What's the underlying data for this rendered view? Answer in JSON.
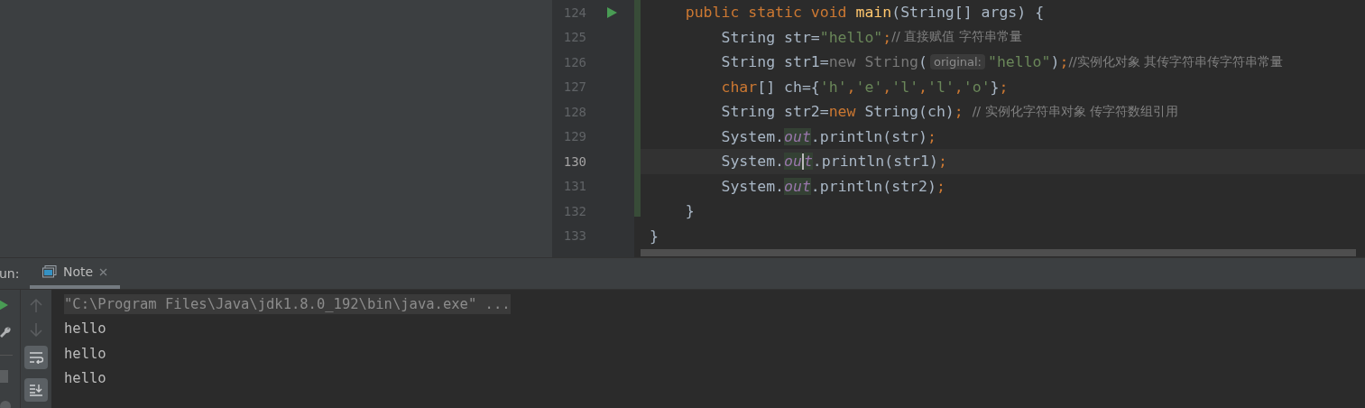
{
  "editor": {
    "lines": [
      {
        "number": "124",
        "current": false,
        "run_marker": true,
        "tokens": [
          {
            "kind": "keyword",
            "text": "    public static void "
          },
          {
            "kind": "method",
            "text": "main"
          },
          {
            "kind": "plain",
            "text": "(String[] args) {"
          }
        ]
      },
      {
        "number": "125",
        "current": false,
        "run_marker": false,
        "tokens": [
          {
            "kind": "plain",
            "text": "        String str="
          },
          {
            "kind": "string",
            "text": "\"hello\""
          },
          {
            "kind": "keyword",
            "text": ";"
          },
          {
            "kind": "comment",
            "text": "// 直接赋值 字符串常量"
          }
        ]
      },
      {
        "number": "126",
        "current": false,
        "run_marker": false,
        "tokens": [
          {
            "kind": "plain",
            "text": "        String str1="
          },
          {
            "kind": "dim",
            "text": "new String"
          },
          {
            "kind": "plain",
            "text": "("
          },
          {
            "kind": "hint",
            "text": "original:"
          },
          {
            "kind": "string",
            "text": "\"hello\""
          },
          {
            "kind": "plain",
            "text": ")"
          },
          {
            "kind": "keyword",
            "text": ";"
          },
          {
            "kind": "comment",
            "text": "//实例化对象 其传字符串传字符串常量"
          }
        ]
      },
      {
        "number": "127",
        "current": false,
        "run_marker": false,
        "tokens": [
          {
            "kind": "keyword",
            "text": "        char"
          },
          {
            "kind": "plain",
            "text": "[] ch={"
          },
          {
            "kind": "string",
            "text": "'h'"
          },
          {
            "kind": "keyword",
            "text": ","
          },
          {
            "kind": "string",
            "text": "'e'"
          },
          {
            "kind": "keyword",
            "text": ","
          },
          {
            "kind": "string",
            "text": "'l'"
          },
          {
            "kind": "keyword",
            "text": ","
          },
          {
            "kind": "string",
            "text": "'l'"
          },
          {
            "kind": "keyword",
            "text": ","
          },
          {
            "kind": "string",
            "text": "'o'"
          },
          {
            "kind": "plain",
            "text": "}"
          },
          {
            "kind": "keyword",
            "text": ";"
          }
        ]
      },
      {
        "number": "128",
        "current": false,
        "run_marker": false,
        "tokens": [
          {
            "kind": "plain",
            "text": "        String str2="
          },
          {
            "kind": "keyword",
            "text": "new "
          },
          {
            "kind": "plain",
            "text": "String(ch)"
          },
          {
            "kind": "keyword",
            "text": "; "
          },
          {
            "kind": "comment",
            "text": "// 实例化字符串对象 传字符数组引用"
          }
        ]
      },
      {
        "number": "129",
        "current": false,
        "run_marker": false,
        "tokens": [
          {
            "kind": "plain",
            "text": "        System."
          },
          {
            "kind": "field",
            "text": "out"
          },
          {
            "kind": "plain",
            "text": ".println(str)"
          },
          {
            "kind": "keyword",
            "text": ";"
          }
        ]
      },
      {
        "number": "130",
        "current": true,
        "run_marker": false,
        "tokens": [
          {
            "kind": "plain",
            "text": "        System."
          },
          {
            "kind": "field",
            "text": "ou"
          },
          {
            "kind": "caret"
          },
          {
            "kind": "field",
            "text": "t"
          },
          {
            "kind": "plain",
            "text": ".println(str1)"
          },
          {
            "kind": "keyword",
            "text": ";"
          }
        ]
      },
      {
        "number": "131",
        "current": false,
        "run_marker": false,
        "tokens": [
          {
            "kind": "plain",
            "text": "        System."
          },
          {
            "kind": "field",
            "text": "out"
          },
          {
            "kind": "plain",
            "text": ".println(str2)"
          },
          {
            "kind": "keyword",
            "text": ";"
          }
        ]
      },
      {
        "number": "132",
        "current": false,
        "run_marker": false,
        "tokens": [
          {
            "kind": "plain",
            "text": "    }"
          }
        ]
      },
      {
        "number": "133",
        "current": false,
        "run_marker": false,
        "tokens": [
          {
            "kind": "plain",
            "text": "}"
          }
        ]
      }
    ]
  },
  "run_panel": {
    "label": "un:",
    "tabs": [
      {
        "label": "Note",
        "selected": true
      }
    ],
    "console": [
      {
        "kind": "command",
        "text": "\"C:\\Program Files\\Java\\jdk1.8.0_192\\bin\\java.exe\" ..."
      },
      {
        "kind": "output",
        "text": "hello"
      },
      {
        "kind": "output",
        "text": "hello"
      },
      {
        "kind": "output",
        "text": "hello"
      }
    ]
  }
}
